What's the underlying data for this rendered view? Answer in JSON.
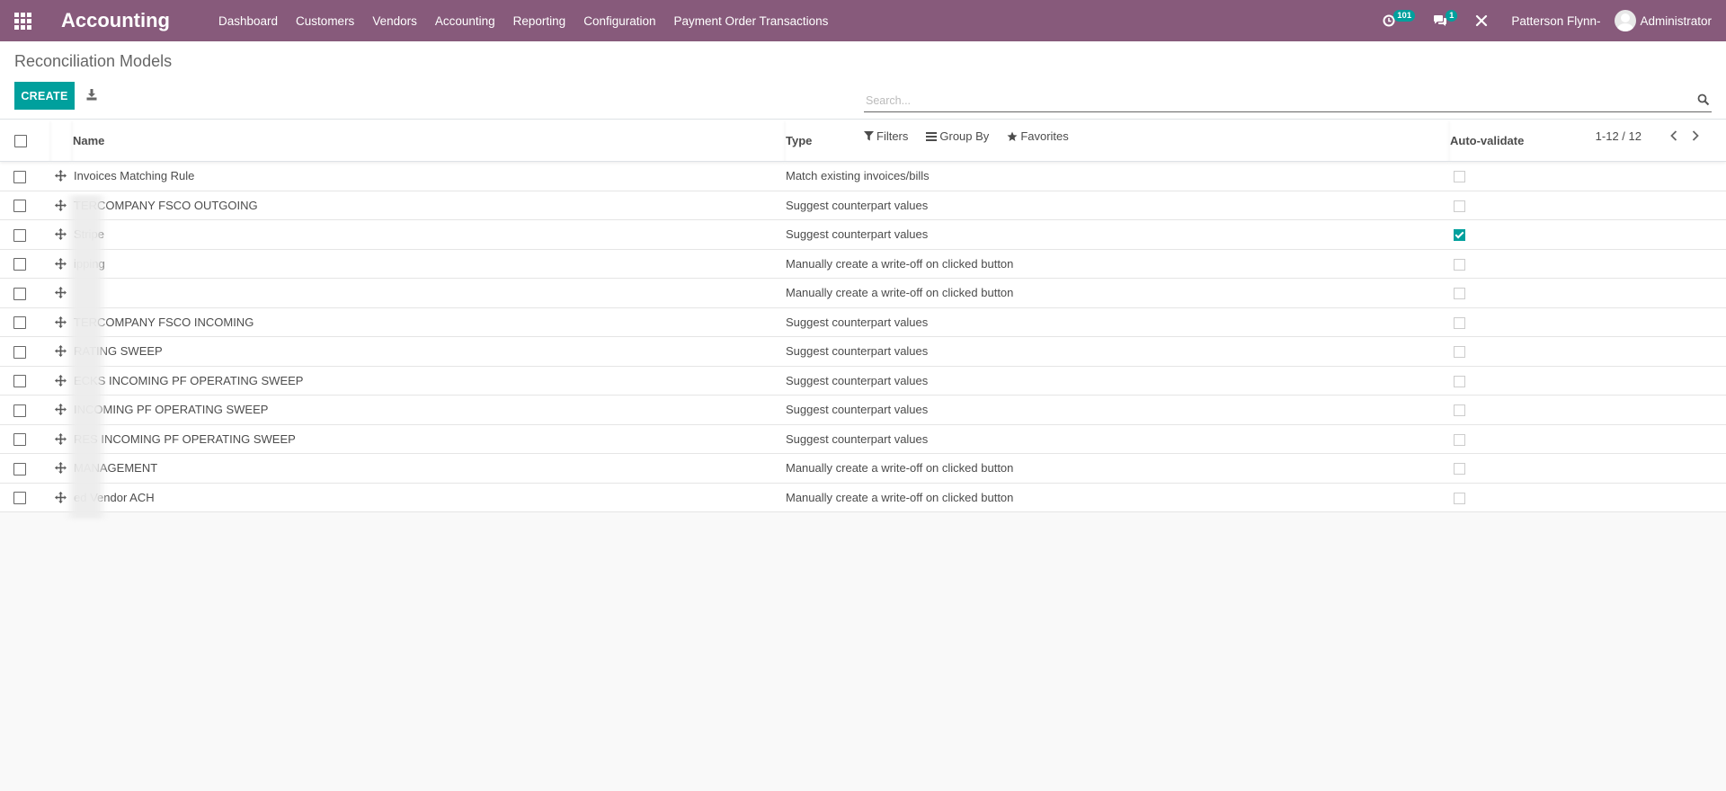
{
  "navbar": {
    "brand": "Accounting",
    "menu": [
      "Dashboard",
      "Customers",
      "Vendors",
      "Accounting",
      "Reporting",
      "Configuration",
      "Payment Order Transactions"
    ],
    "activity_badge": "101",
    "messages_badge": "1",
    "company": "Patterson Flynn-",
    "user": "Administrator",
    "colors": {
      "bar": "#875a7b",
      "badge": "#00a09d"
    }
  },
  "control_panel": {
    "title": "Reconciliation Models",
    "create_label": "CREATE",
    "search_placeholder": "Search...",
    "filters_label": "Filters",
    "groupby_label": "Group By",
    "favorites_label": "Favorites",
    "pager": "1-12 / 12"
  },
  "table": {
    "headers": {
      "name": "Name",
      "type": "Type",
      "auto_validate": "Auto-validate"
    },
    "rows": [
      {
        "name": "Invoices Matching Rule",
        "type": "Match existing invoices/bills",
        "auto": false
      },
      {
        "name": "TERCOMPANY FSCO OUTGOING",
        "type": "Suggest counterpart values",
        "auto": false
      },
      {
        "name": "Stripe",
        "type": "Suggest counterpart values",
        "auto": true
      },
      {
        "name": "ipping",
        "type": "Manually create a write-off on clicked button",
        "auto": false
      },
      {
        "name": "",
        "type": "Manually create a write-off on clicked button",
        "auto": false
      },
      {
        "name": "TERCOMPANY FSCO INCOMING",
        "type": "Suggest counterpart values",
        "auto": false
      },
      {
        "name": "RATING SWEEP",
        "type": "Suggest counterpart values",
        "auto": false
      },
      {
        "name": "ECKS INCOMING PF OPERATING SWEEP",
        "type": "Suggest counterpart values",
        "auto": false
      },
      {
        "name": "INCOMING PF OPERATING SWEEP",
        "type": "Suggest counterpart values",
        "auto": false
      },
      {
        "name": "RES INCOMING PF OPERATING SWEEP",
        "type": "Suggest counterpart values",
        "auto": false
      },
      {
        "name": "MANAGEMENT",
        "type": "Manually create a write-off on clicked button",
        "auto": false
      },
      {
        "name": "ed Vendor ACH",
        "type": "Manually create a write-off on clicked button",
        "auto": false
      }
    ]
  }
}
